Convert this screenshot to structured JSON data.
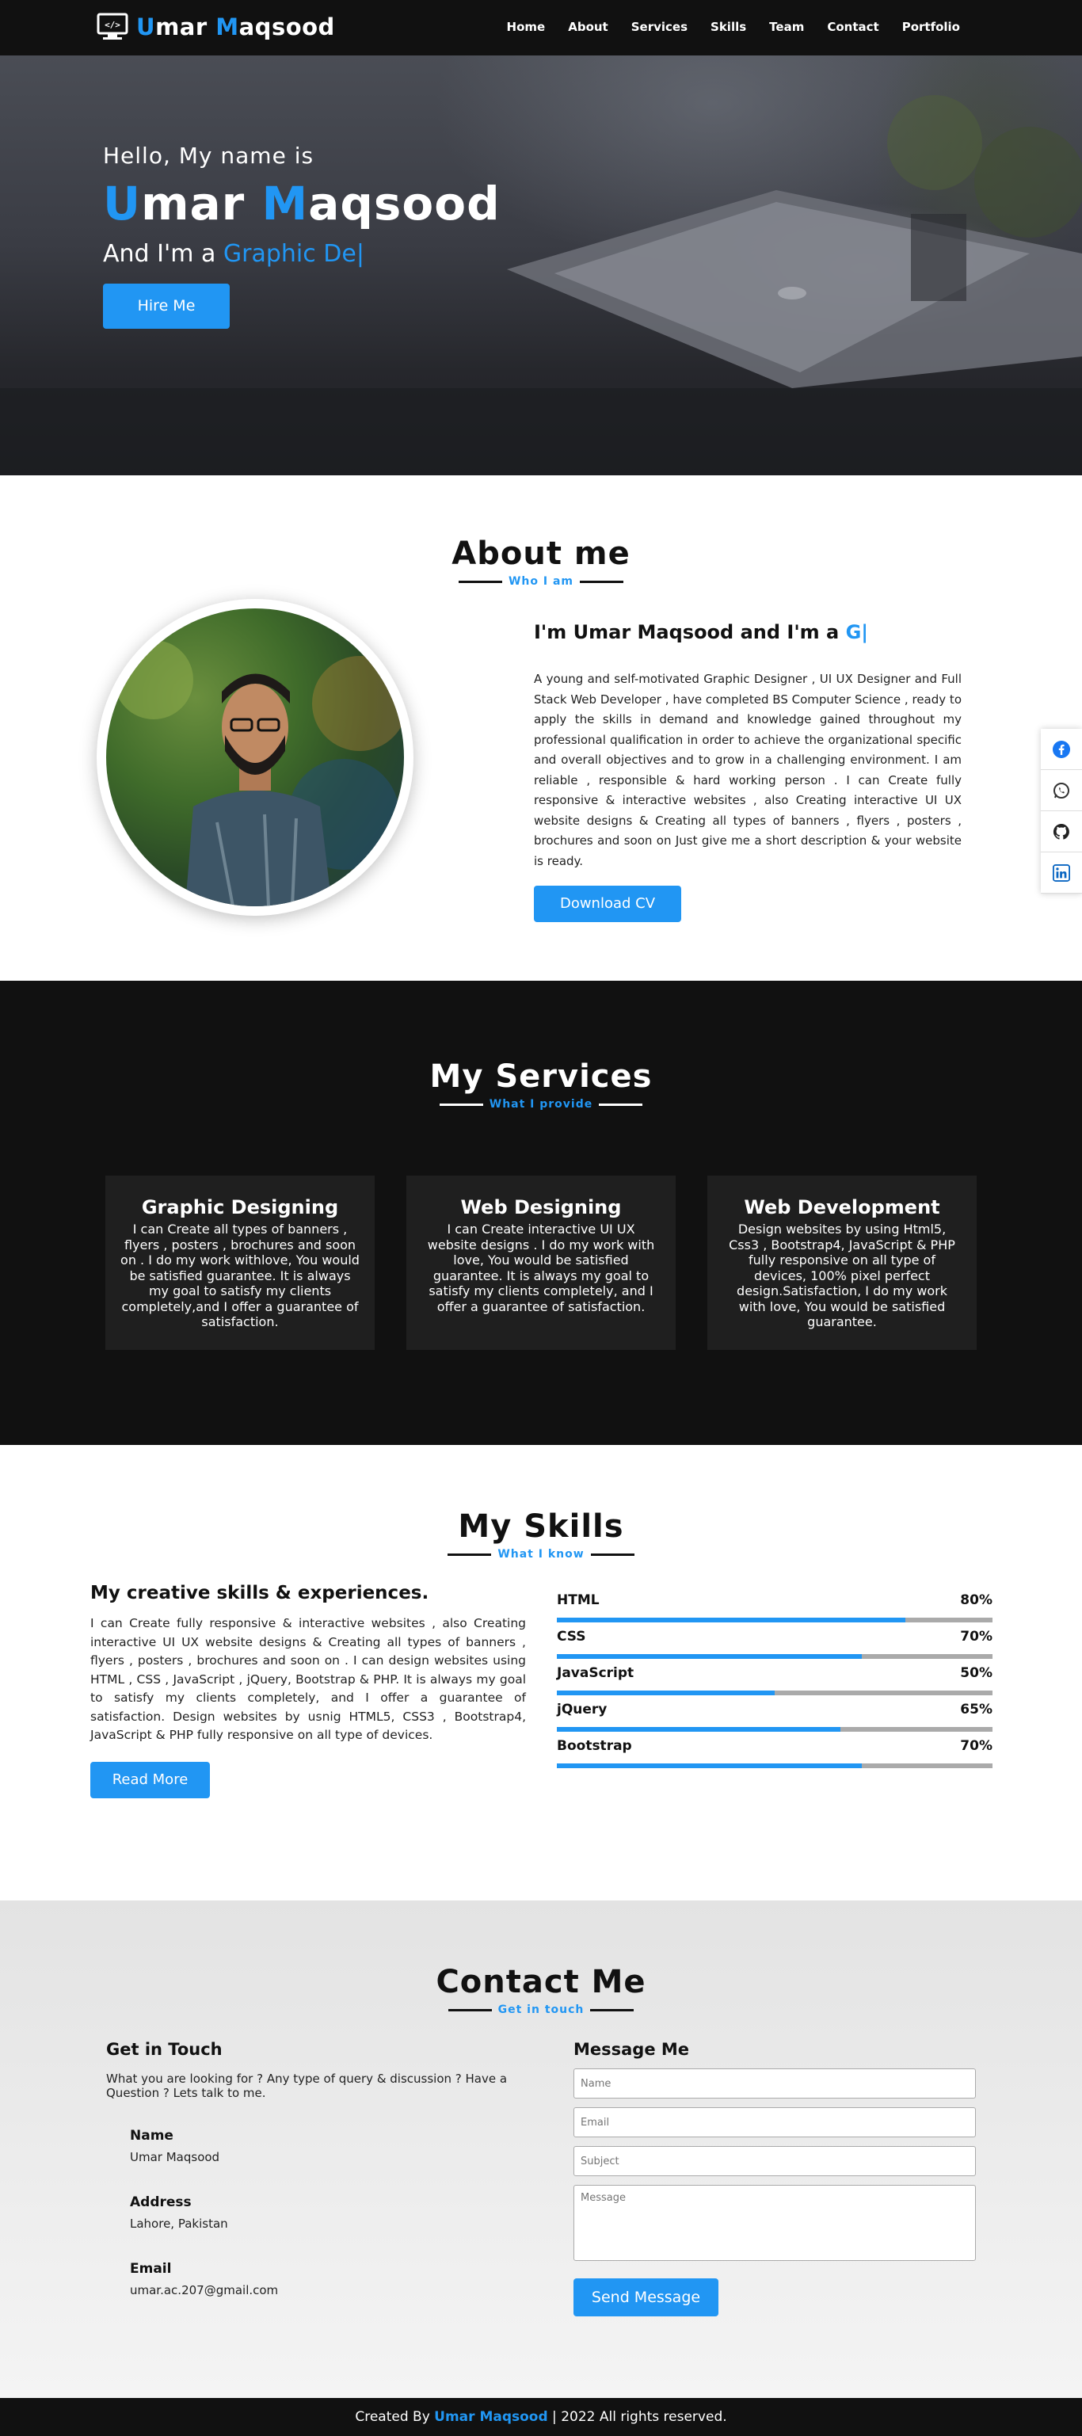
{
  "nav": {
    "brand_first": "U",
    "brand_rest1": "mar ",
    "brand_cap2": "M",
    "brand_rest2": "aqsood",
    "items": [
      "Home",
      "About",
      "Services",
      "Skills",
      "Team",
      "Contact",
      "Portfolio"
    ]
  },
  "hero": {
    "hello": "Hello, My name is",
    "name_cap1": "U",
    "name_rest1": "mar ",
    "name_cap2": "M",
    "name_rest2": "aqsood",
    "role_prefix": "And I'm a ",
    "role_typed": "Graphic De|",
    "hire_label": "Hire Me"
  },
  "about": {
    "title": "About me",
    "subtitle": "Who I am",
    "heading_prefix": "I'm Umar Maqsood and I'm a ",
    "heading_typed": "G|",
    "text": "A young and self-motivated Graphic Designer , UI UX Designer and Full Stack Web Developer , have completed BS Computer Science , ready to apply the skills in demand and knowledge gained throughout my professional qualification in order to achieve the organizational specific and overall objectives and to grow in a challenging environment. I am reliable , responsible & hard working person . I can Create fully responsive & interactive websites , also Creating interactive UI UX website designs & Creating all types of banners , flyers , posters , brochures and soon on Just give me a short description & your website is ready.",
    "cv_label": "Download CV"
  },
  "social": [
    "facebook-icon",
    "whatsapp-icon",
    "github-icon",
    "linkedin-icon"
  ],
  "services": {
    "title": "My Services",
    "subtitle": "What I provide",
    "cards": [
      {
        "title": "Graphic Designing",
        "text": "I can Create all types of banners , flyers , posters , brochures and soon on . I do my work withlove, You would be satisfied guarantee. It is always my goal to satisfy my clients completely,and I offer a guarantee of satisfaction."
      },
      {
        "title": "Web Designing",
        "text": "I can Create interactive UI UX website designs . I do my work with love, You would be satisfied guarantee. It is always my goal to satisfy my clients completely, and I offer a guarantee of satisfaction."
      },
      {
        "title": "Web Development",
        "text": "Design websites by using Html5, Css3 , Bootstrap4, JavaScript & PHP fully responsive on all type of devices, 100% pixel perfect design.Satisfaction, I do my work with love, You would be satisfied guarantee."
      }
    ]
  },
  "skills": {
    "title": "My Skills",
    "subtitle": "What I know",
    "heading": "My creative skills & experiences.",
    "text": "I can Create fully responsive & interactive websites , also Creating interactive UI UX website designs & Creating all types of banners , flyers , posters , brochures and soon on . I can design websites using HTML , CSS , JavaScript , jQuery, Bootstrap & PHP. It is always my goal to satisfy my clients completely, and I offer a guarantee of satisfaction. Design websites by usnig HTML5, CSS3 , Bootstrap4, JavaScript & PHP fully responsive on all type of devices.",
    "readmore_label": "Read More",
    "items": [
      {
        "name": "HTML",
        "percent_label": "80%",
        "value": 80
      },
      {
        "name": "CSS",
        "percent_label": "70%",
        "value": 70
      },
      {
        "name": "JavaScript",
        "percent_label": "50%",
        "value": 50
      },
      {
        "name": "jQuery",
        "percent_label": "65%",
        "value": 65
      },
      {
        "name": "Bootstrap",
        "percent_label": "70%",
        "value": 70
      }
    ]
  },
  "contact": {
    "title": "Contact Me",
    "subtitle": "Get in touch",
    "get_in_touch": "Get in Touch",
    "desc": "What you are looking for ? Any type of query & discussion ? Have a Question ? Lets talk to me.",
    "info": [
      {
        "label": "Name",
        "value": "Umar Maqsood"
      },
      {
        "label": "Address",
        "value": "Lahore, Pakistan"
      },
      {
        "label": "Email",
        "value": "umar.ac.207@gmail.com"
      }
    ],
    "message_me": "Message Me",
    "placeholders": {
      "name": "Name",
      "email": "Email",
      "subject": "Subject",
      "message": "Message"
    },
    "send_label": "Send Message"
  },
  "footer": {
    "prefix": "Created By ",
    "name": "Umar Maqsood",
    "suffix": " | 2022 All rights reserved."
  },
  "colors": {
    "accent": "#2196f3",
    "dark": "#111111",
    "card": "#1f1f1f"
  }
}
